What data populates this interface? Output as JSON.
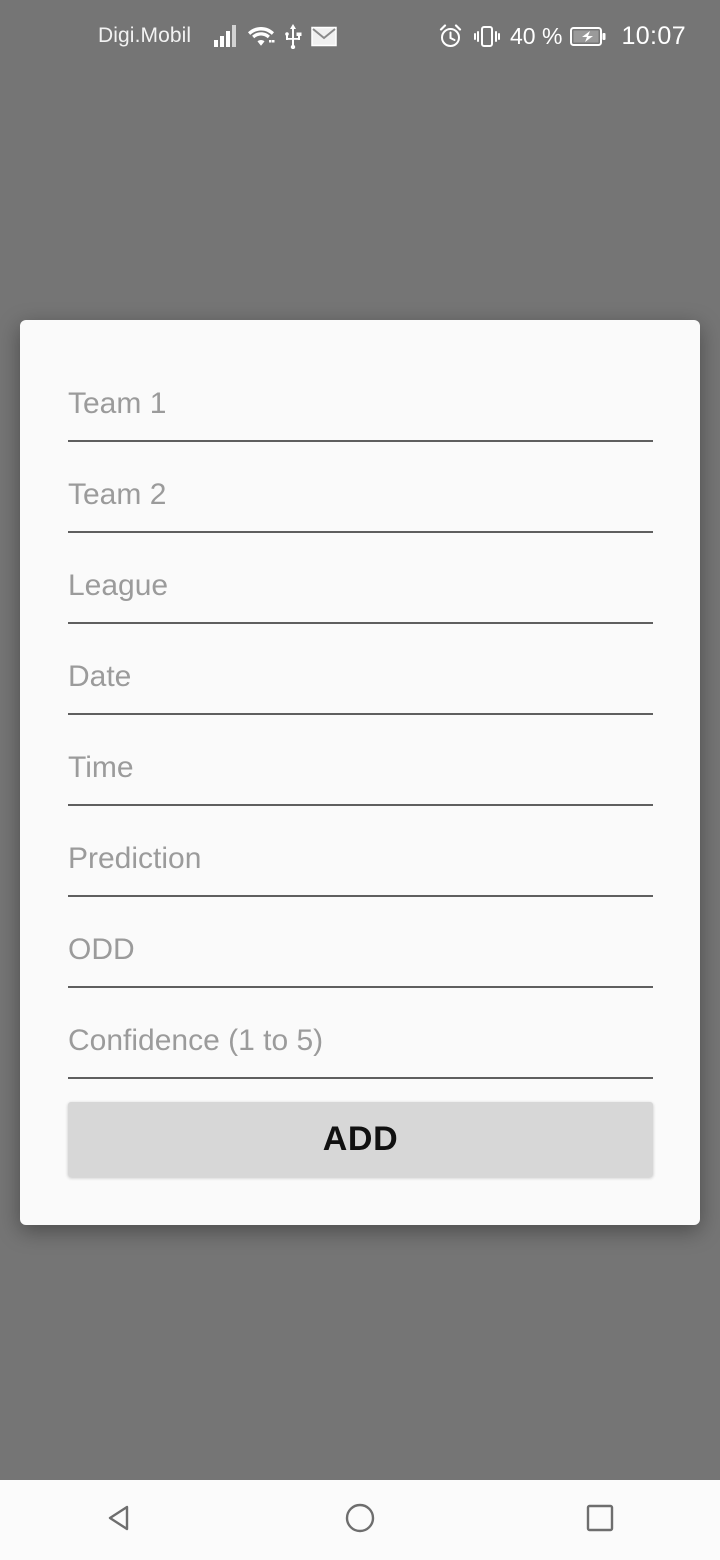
{
  "status_bar": {
    "carrier": "Digi.Mobil",
    "battery_percent": "40 %",
    "clock": "10:07",
    "left_icons": [
      "signal-bars-icon",
      "wifi-icon",
      "usb-icon",
      "mail-icon"
    ],
    "right_icons": [
      "alarm-clock-icon",
      "vibrate-icon",
      "battery-charging-icon"
    ],
    "text_color": "#ffffff",
    "background_color": "#757575"
  },
  "scrim": {
    "color": "#757575"
  },
  "dialog": {
    "background_color": "#fafafa",
    "fields": [
      {
        "name": "team1",
        "placeholder": "Team 1",
        "value": ""
      },
      {
        "name": "team2",
        "placeholder": "Team 2",
        "value": ""
      },
      {
        "name": "league",
        "placeholder": "League",
        "value": ""
      },
      {
        "name": "date",
        "placeholder": "Date",
        "value": ""
      },
      {
        "name": "time",
        "placeholder": "Time",
        "value": ""
      },
      {
        "name": "prediction",
        "placeholder": "Prediction",
        "value": ""
      },
      {
        "name": "odd",
        "placeholder": "ODD",
        "value": ""
      },
      {
        "name": "confidence",
        "placeholder": "Confidence (1 to 5)",
        "value": ""
      }
    ],
    "submit": {
      "label": "ADD",
      "background_color": "#d7d7d7",
      "text_color": "#111111"
    }
  },
  "nav_bar": {
    "background_color": "#fbfbfb",
    "buttons": [
      {
        "name": "back",
        "icon": "back-triangle-icon"
      },
      {
        "name": "home",
        "icon": "home-circle-icon"
      },
      {
        "name": "recents",
        "icon": "recents-square-icon"
      }
    ]
  }
}
